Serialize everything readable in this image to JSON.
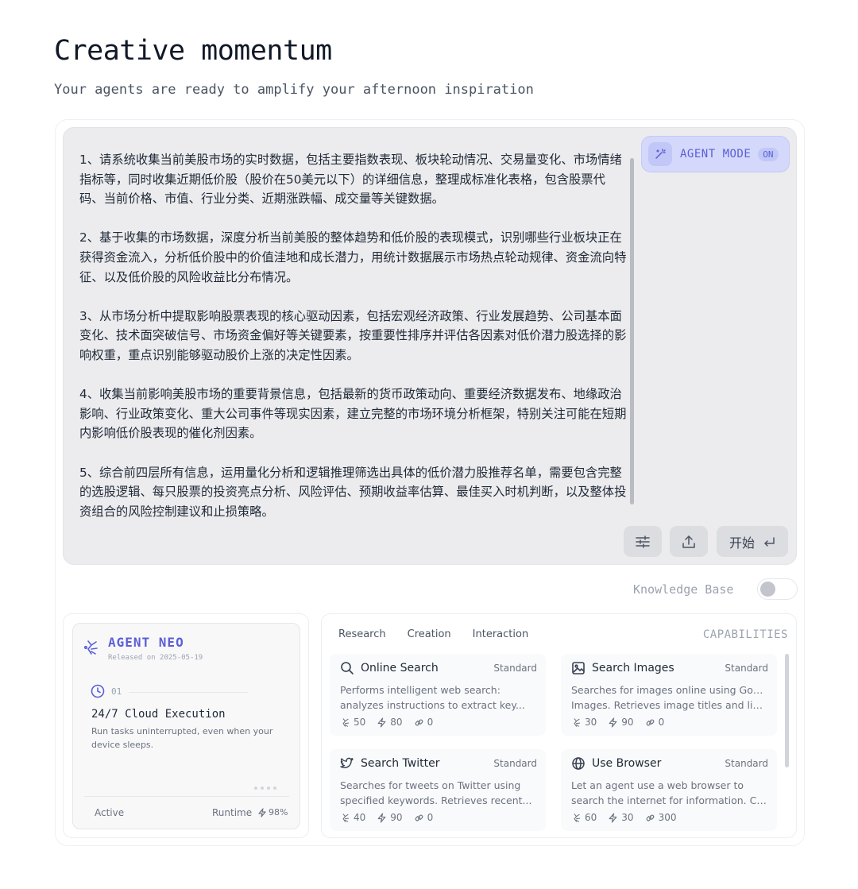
{
  "header": {
    "title": "Creative momentum",
    "subtitle": "Your agents are ready to amplify your afternoon inspiration"
  },
  "composer": {
    "paragraphs": [
      "1、请系统收集当前美股市场的实时数据，包括主要指数表现、板块轮动情况、交易量变化、市场情绪指标等，同时收集近期低价股（股价在50美元以下）的详细信息，整理成标准化表格，包含股票代码、当前价格、市值、行业分类、近期涨跌幅、成交量等关键数据。",
      "2、基于收集的市场数据，深度分析当前美股的整体趋势和低价股的表现模式，识别哪些行业板块正在获得资金流入，分析低价股中的价值洼地和成长潜力，用统计数据展示市场热点轮动规律、资金流向特征、以及低价股的风险收益比分布情况。",
      "3、从市场分析中提取影响股票表现的核心驱动因素，包括宏观经济政策、行业发展趋势、公司基本面变化、技术面突破信号、市场资金偏好等关键要素，按重要性排序并评估各因素对低价潜力股选择的影响权重，重点识别能够驱动股价上涨的决定性因素。",
      "4、收集当前影响美股市场的重要背景信息，包括最新的货币政策动向、重要经济数据发布、地缘政治影响、行业政策变化、重大公司事件等现实因素，建立完整的市场环境分析框架，特别关注可能在短期内影响低价股表现的催化剂因素。",
      "5、综合前四层所有信息，运用量化分析和逻辑推理筛选出具体的低价潜力股推荐名单，需要包含完整的选股逻辑、每只股票的投资亮点分析、风险评估、预期收益率估算、最佳买入时机判断，以及整体投资组合的风险控制建议和止损策略。"
    ],
    "agent_mode_label": "AGENT MODE",
    "agent_mode_state": "ON",
    "start_label": "开始",
    "accent": "#5b5fd6"
  },
  "knowledge_base": {
    "label": "Knowledge Base",
    "enabled": false
  },
  "agent": {
    "name": "AGENT NEO",
    "released": "Released on 2025-05-19",
    "step": "01",
    "feature_title": "24/7 Cloud Execution",
    "feature_desc": "Run tasks uninterrupted, even when your device sleeps.",
    "status": "Active",
    "runtime_label": "Runtime",
    "runtime_value": "98%"
  },
  "capabilities": {
    "title": "CAPABILITIES",
    "tabs": [
      "Research",
      "Creation",
      "Interaction"
    ],
    "cards": [
      {
        "name": "Online Search",
        "tag": "Standard",
        "line1": "Performs intelligent web search:",
        "line2": "analyzes instructions to extract key...",
        "s1": "50",
        "s2": "80",
        "s3": "0"
      },
      {
        "name": "Search Images",
        "tag": "Standard",
        "line1": "Searches for images online using Google",
        "line2": "Images. Retrieves image titles and link...",
        "s1": "30",
        "s2": "90",
        "s3": "0"
      },
      {
        "name": "Search Twitter",
        "tag": "Standard",
        "line1": "Searches for tweets on Twitter using",
        "line2": "specified keywords. Retrieves recent...",
        "s1": "40",
        "s2": "90",
        "s3": "0"
      },
      {
        "name": "Use Browser",
        "tag": "Standard",
        "line1": "Let an agent use a web browser to",
        "line2": "search the internet for information. Ca...",
        "s1": "60",
        "s2": "30",
        "s3": "300"
      }
    ]
  }
}
